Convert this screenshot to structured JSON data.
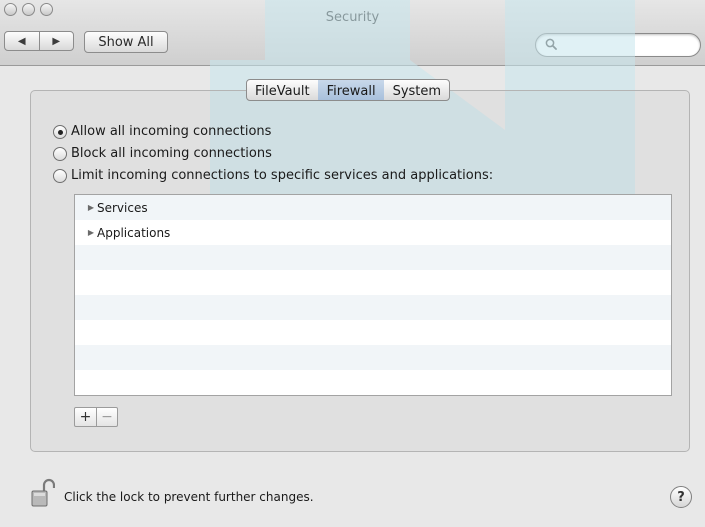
{
  "window": {
    "title": "Security"
  },
  "toolbar": {
    "back_icon": "back-arrow-icon",
    "forward_icon": "forward-arrow-icon",
    "back_glyph": "◀",
    "forward_glyph": "▶",
    "show_all_label": "Show All",
    "search": {
      "value": "",
      "placeholder": ""
    }
  },
  "tabs": [
    {
      "label": "FileVault",
      "selected": false
    },
    {
      "label": "Firewall",
      "selected": true
    },
    {
      "label": "System",
      "selected": false
    }
  ],
  "firewall": {
    "options": [
      {
        "label": "Allow all incoming connections",
        "checked": true
      },
      {
        "label": "Block all incoming connections",
        "checked": false
      },
      {
        "label": "Limit incoming connections to specific services and applications:",
        "checked": false
      }
    ],
    "list_items": [
      {
        "label": "Services",
        "icon": "disclosure-triangle-icon",
        "glyph": "▶"
      },
      {
        "label": "Applications",
        "icon": "disclosure-triangle-icon",
        "glyph": "▶"
      }
    ],
    "add_glyph": "+",
    "remove_glyph": "−"
  },
  "footer": {
    "lock_text": "Click the lock to prevent further changes.",
    "help_glyph": "?"
  },
  "colors": {
    "watermark": "#c8e6ec",
    "selected_tab": "#a8c0dc",
    "row_alt": "#f1f5f8"
  }
}
